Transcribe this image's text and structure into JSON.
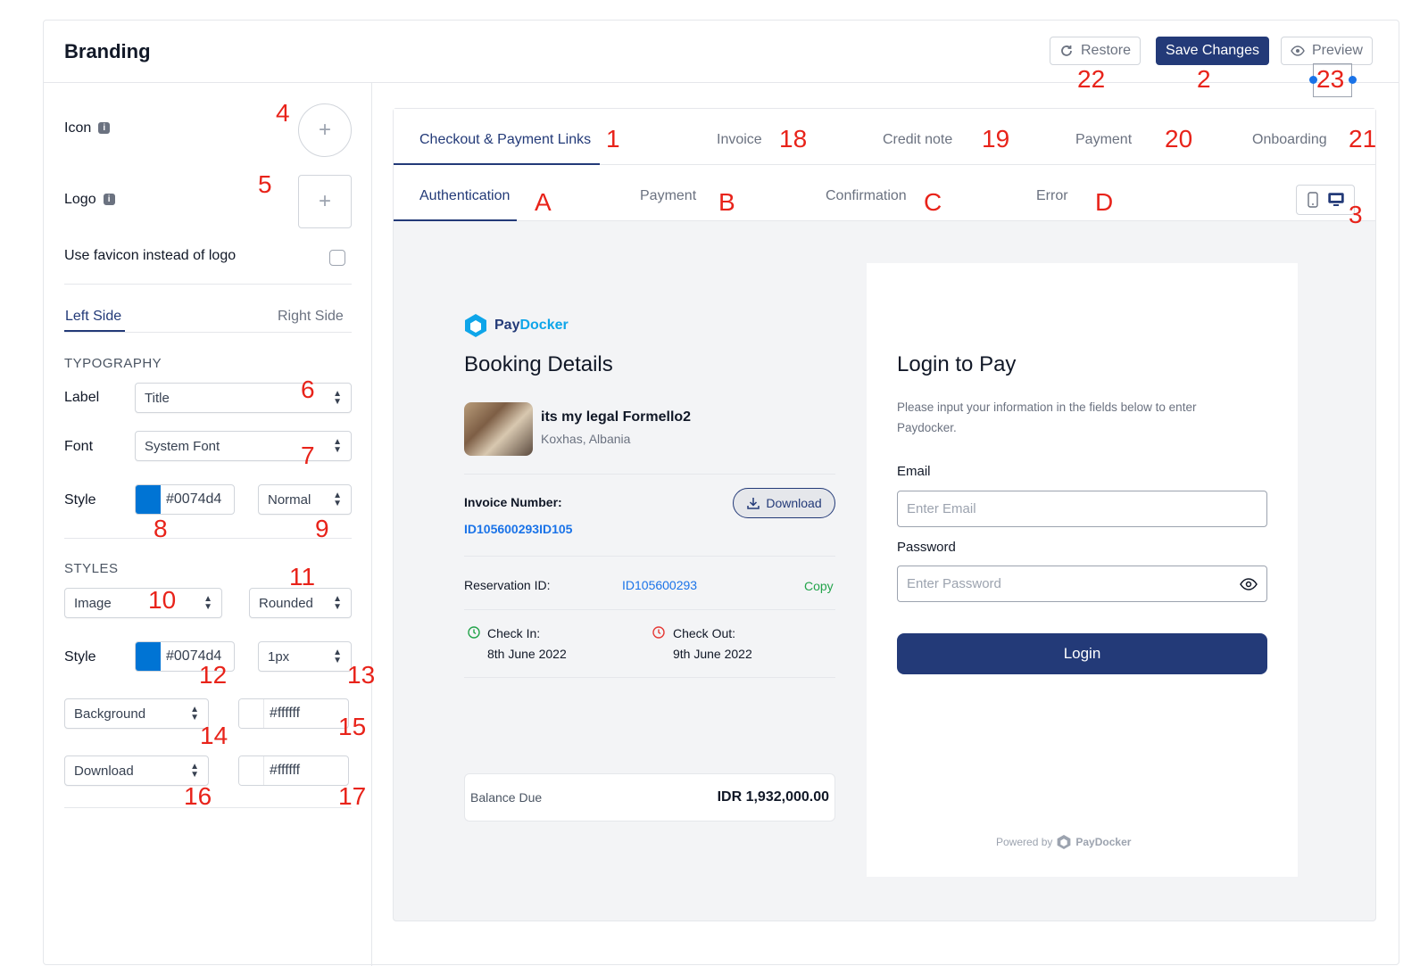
{
  "header": {
    "title": "Branding",
    "restore_label": "Restore",
    "save_label": "Save Changes",
    "preview_label": "Preview"
  },
  "annotations": {
    "n1": "1",
    "n2": "2",
    "n3": "3",
    "n4": "4",
    "n5": "5",
    "n6": "6",
    "n7": "7",
    "n8": "8",
    "n9": "9",
    "n10": "10",
    "n11": "11",
    "n12": "12",
    "n13": "13",
    "n14": "14",
    "n15": "15",
    "n16": "16",
    "n17": "17",
    "n18": "18",
    "n19": "19",
    "n20": "20",
    "n21": "21",
    "n22": "22",
    "n23": "23",
    "a": "A",
    "b": "B",
    "c": "C",
    "d": "D"
  },
  "sidebar": {
    "icon_label": "Icon",
    "logo_label": "Logo",
    "favicon_label": "Use favicon instead of logo",
    "side_tabs": [
      "Left Side",
      "Right Side"
    ],
    "typography_heading": "TYPOGRAPHY",
    "label_label": "Label",
    "label_value": "Title",
    "font_label": "Font",
    "font_value": "System Font",
    "style_label": "Style",
    "typo_color": "#0074d4",
    "typo_weight": "Normal",
    "styles_heading": "STYLES",
    "styles_type": "Image",
    "styles_shape": "Rounded",
    "styles_style_label": "Style",
    "styles_color": "#0074d4",
    "styles_border": "1px",
    "background_label": "Background",
    "background_color": "#ffffff",
    "download_label": "Download",
    "download_color": "#ffffff"
  },
  "colors": {
    "accent": "#233a78",
    "swatch_blue": "#0074d4",
    "annotation": "#e8231a"
  },
  "main": {
    "tabs": [
      "Checkout & Payment Links",
      "Invoice",
      "Credit note",
      "Payment",
      "Onboarding"
    ],
    "subtabs": [
      "Authentication",
      "Payment",
      "Confirmation",
      "Error"
    ]
  },
  "preview": {
    "brand_pay": "Pay",
    "brand_docker": "Docker",
    "booking_title": "Booking Details",
    "property_name": "its my legal Formello2",
    "property_location": "Koxhas, Albania",
    "invoice_label": "Invoice Number:",
    "invoice_number": "ID105600293ID105",
    "download_label": "Download",
    "reservation_label": "Reservation ID:",
    "reservation_id": "ID105600293",
    "copy_label": "Copy",
    "checkin_label": "Check In:",
    "checkin_date": "8th June 2022",
    "checkout_label": "Check Out:",
    "checkout_date": "9th June 2022",
    "balance_label": "Balance Due",
    "balance_value": "IDR 1,932,000.00",
    "login_title": "Login to Pay",
    "login_desc": "Please input your information in the fields below to enter Paydocker.",
    "email_label": "Email",
    "email_placeholder": "Enter Email",
    "password_label": "Password",
    "password_placeholder": "Enter Password",
    "login_button": "Login",
    "powered_by": "Powered by",
    "powered_brand": "PayDocker"
  }
}
